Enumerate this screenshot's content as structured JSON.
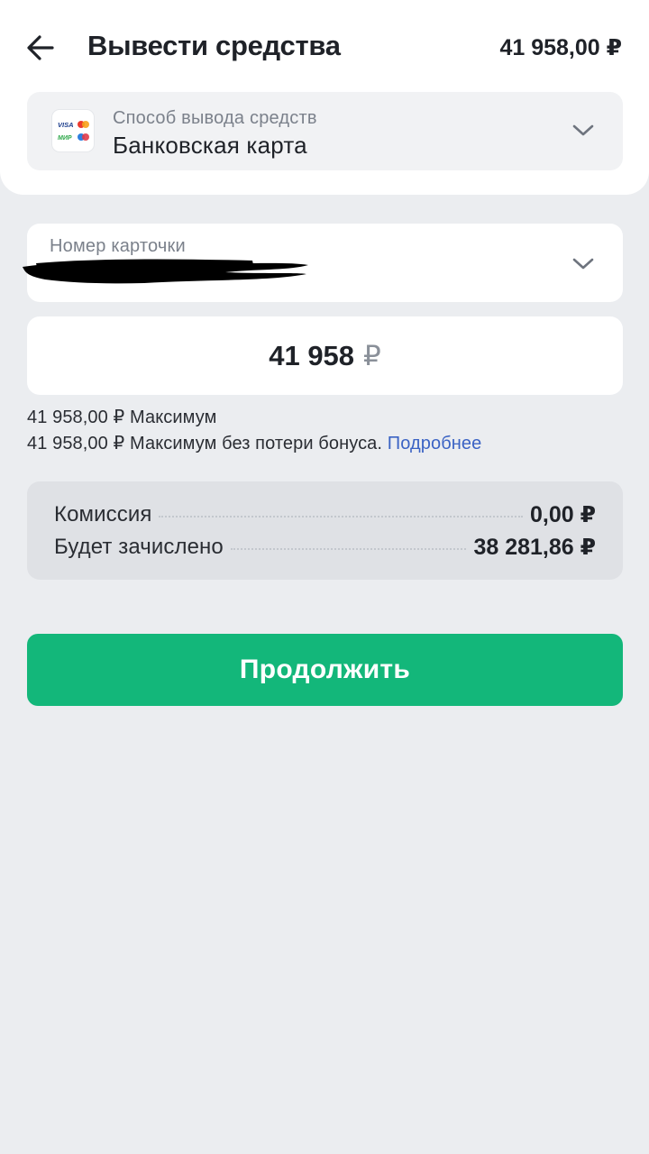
{
  "header": {
    "title": "Вывести средства",
    "balance": "41 958,00 ₽"
  },
  "method": {
    "label": "Способ вывода средств",
    "value": "Банковская карта",
    "logo_text_1": "VISA",
    "logo_text_2": "МИР"
  },
  "card_field": {
    "label": "Номер карточки"
  },
  "amount": {
    "value": "41 958",
    "currency": "₽"
  },
  "hints": {
    "max": "41 958,00 ₽ Максимум",
    "max_no_bonus": "41 958,00 ₽ Максимум без потери бонуса. ",
    "more_link": "Подробнее"
  },
  "summary": {
    "rows": [
      {
        "label": "Комиссия",
        "value": "0,00 ₽"
      },
      {
        "label": "Будет зачислено",
        "value": "38 281,86 ₽"
      }
    ]
  },
  "actions": {
    "continue_label": "Продолжить"
  },
  "colors": {
    "accent_green": "#13b77a",
    "link_blue": "#3b63c4",
    "background": "#ebedf0"
  }
}
